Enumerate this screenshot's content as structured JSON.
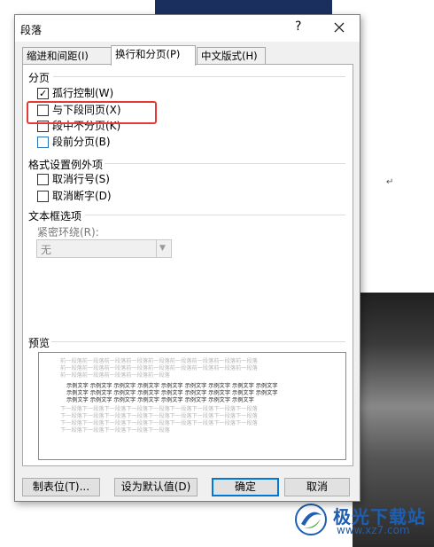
{
  "dialog": {
    "title": "段落",
    "help_symbol": "?",
    "tabs": [
      {
        "label": "缩进和间距(I)"
      },
      {
        "label": "换行和分页(P)",
        "selected": true
      },
      {
        "label": "中文版式(H)"
      }
    ],
    "pagination": {
      "heading": "分页",
      "options": [
        {
          "label": "孤行控制(W)",
          "checked": true
        },
        {
          "label": "与下段同页(X)",
          "checked": false,
          "highlighted": true
        },
        {
          "label": "段中不分页(K)",
          "checked": false
        },
        {
          "label": "段前分页(B)",
          "checked": false
        }
      ]
    },
    "formatting_exceptions": {
      "heading": "格式设置例外项",
      "options": [
        {
          "label": "取消行号(S)",
          "checked": false
        },
        {
          "label": "取消断字(D)",
          "checked": false
        }
      ]
    },
    "textbox_options": {
      "heading": "文本框选项",
      "wrap_label": "紧密环绕(R):",
      "wrap_value": "无"
    },
    "preview": {
      "heading": "预览",
      "before_text": [
        "前一段落前一段落前一段落前一段落前一段落前一段落前一段落前一段落前一段落",
        "前一段落前一段落前一段落前一段落前一段落前一段落前一段落前一段落前一段落",
        "前一段落前一段落前一段落前一段落前一段落"
      ],
      "sample_text": [
        "示例文字 示例文字 示例文字 示例文字 示例文字 示例文字 示例文字 示例文字 示例文字",
        "示例文字 示例文字 示例文字 示例文字 示例文字 示例文字 示例文字 示例文字 示例文字",
        "示例文字 示例文字 示例文字 示例文字 示例文字 示例文字 示例文字 示例文字"
      ],
      "after_text": [
        "下一段落下一段落下一段落下一段落下一段落下一段落下一段落下一段落下一段落",
        "下一段落下一段落下一段落下一段落下一段落下一段落下一段落下一段落下一段落",
        "下一段落下一段落下一段落下一段落下一段落下一段落下一段落下一段落下一段落",
        "下一段落下一段落下一段落下一段落下一段落"
      ]
    },
    "buttons": {
      "tabs": "制表位(T)...",
      "set_default": "设为默认值(D)",
      "ok": "确定",
      "cancel": "取消"
    }
  },
  "document": {
    "paragraph_mark": "↵"
  },
  "watermark": {
    "name": "极光下载站",
    "url": "www.xz7.com"
  },
  "colors": {
    "highlight_box": "#e53935",
    "default_button_border": "#0078d7",
    "watermark": "#1d5fb3"
  }
}
